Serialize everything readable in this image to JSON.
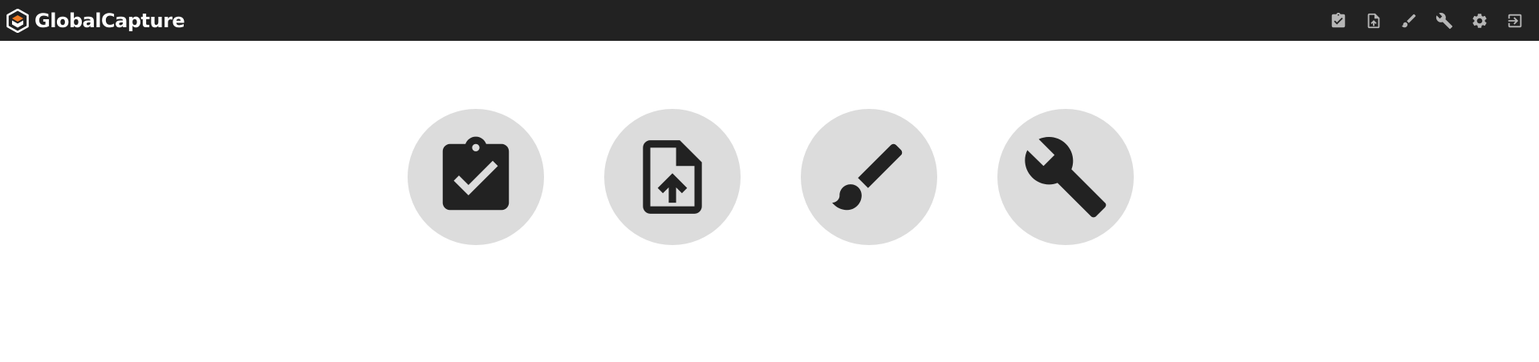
{
  "header": {
    "brand_name": "GlobalCapture",
    "brand_logo": "globalcapture-cube-logo",
    "background_color": "#222222",
    "toolbar": [
      {
        "icon": "clipboard-check-icon"
      },
      {
        "icon": "file-upload-icon"
      },
      {
        "icon": "brush-icon"
      },
      {
        "icon": "wrench-icon"
      },
      {
        "icon": "gear-icon"
      },
      {
        "icon": "logout-icon"
      }
    ]
  },
  "main": {
    "tile_color": "#dcdcdc",
    "icon_color": "#222222",
    "tiles": [
      {
        "icon": "clipboard-check-icon"
      },
      {
        "icon": "file-upload-icon"
      },
      {
        "icon": "brush-icon"
      },
      {
        "icon": "wrench-icon"
      }
    ]
  }
}
